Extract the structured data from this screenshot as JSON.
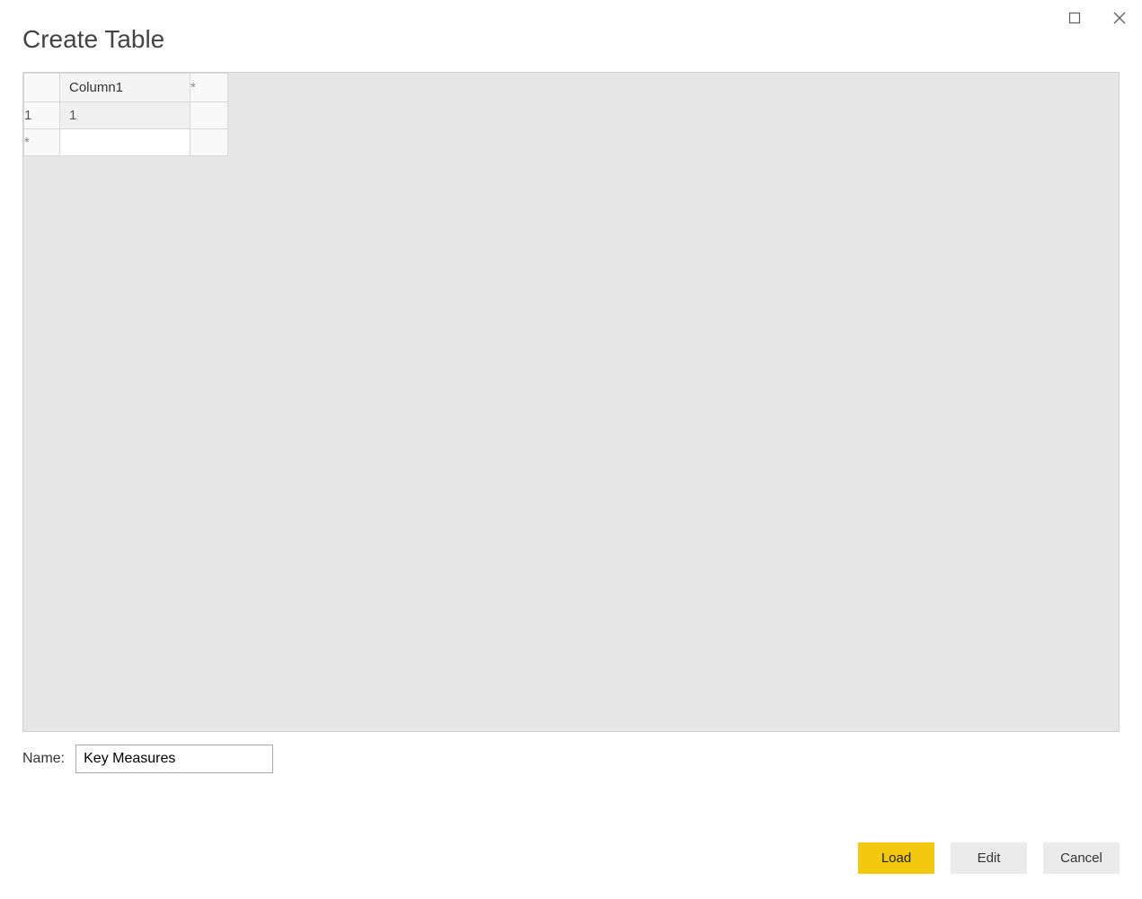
{
  "dialog": {
    "title": "Create Table"
  },
  "grid": {
    "columns": [
      {
        "label": "Column1"
      }
    ],
    "addColumnGlyph": "*",
    "rows": [
      {
        "num": "1",
        "cells": [
          "1"
        ]
      }
    ],
    "newRowGlyph": "*"
  },
  "name": {
    "label": "Name:",
    "value": "Key Measures"
  },
  "buttons": {
    "load": "Load",
    "edit": "Edit",
    "cancel": "Cancel"
  }
}
